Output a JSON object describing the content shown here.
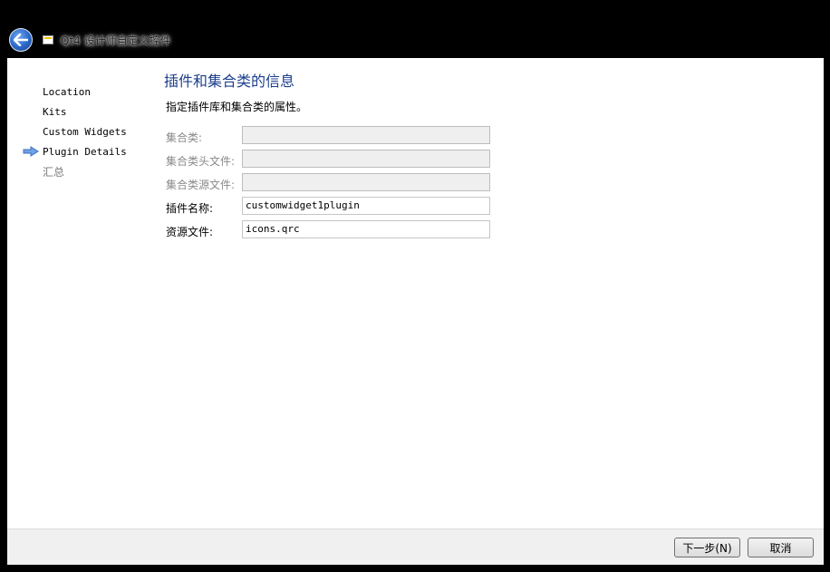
{
  "window": {
    "title": "Qt4 设计师自定义控件"
  },
  "nav": {
    "items": [
      {
        "label": "Location",
        "state": "done"
      },
      {
        "label": "Kits",
        "state": "done"
      },
      {
        "label": "Custom Widgets",
        "state": "done"
      },
      {
        "label": "Plugin Details",
        "state": "current"
      },
      {
        "label": "汇总",
        "state": "pending"
      }
    ],
    "current_indicator_icon": "arrow-right-icon"
  },
  "page": {
    "heading": "插件和集合类的信息",
    "subheading": "指定插件库和集合类的属性。",
    "fields": [
      {
        "label": "集合类:",
        "value": "",
        "enabled": false
      },
      {
        "label": "集合类头文件:",
        "value": "",
        "enabled": false
      },
      {
        "label": "集合类源文件:",
        "value": "",
        "enabled": false
      },
      {
        "label": "插件名称:",
        "value": "customwidget1plugin",
        "enabled": true
      },
      {
        "label": "资源文件:",
        "value": "icons.qrc",
        "enabled": true
      }
    ]
  },
  "buttons": {
    "next_label": "下一步(N)",
    "cancel_label": "取消"
  },
  "colors": {
    "heading": "#1c3f8c",
    "titlebar": "#000000",
    "footer": "#f0f0f0"
  }
}
